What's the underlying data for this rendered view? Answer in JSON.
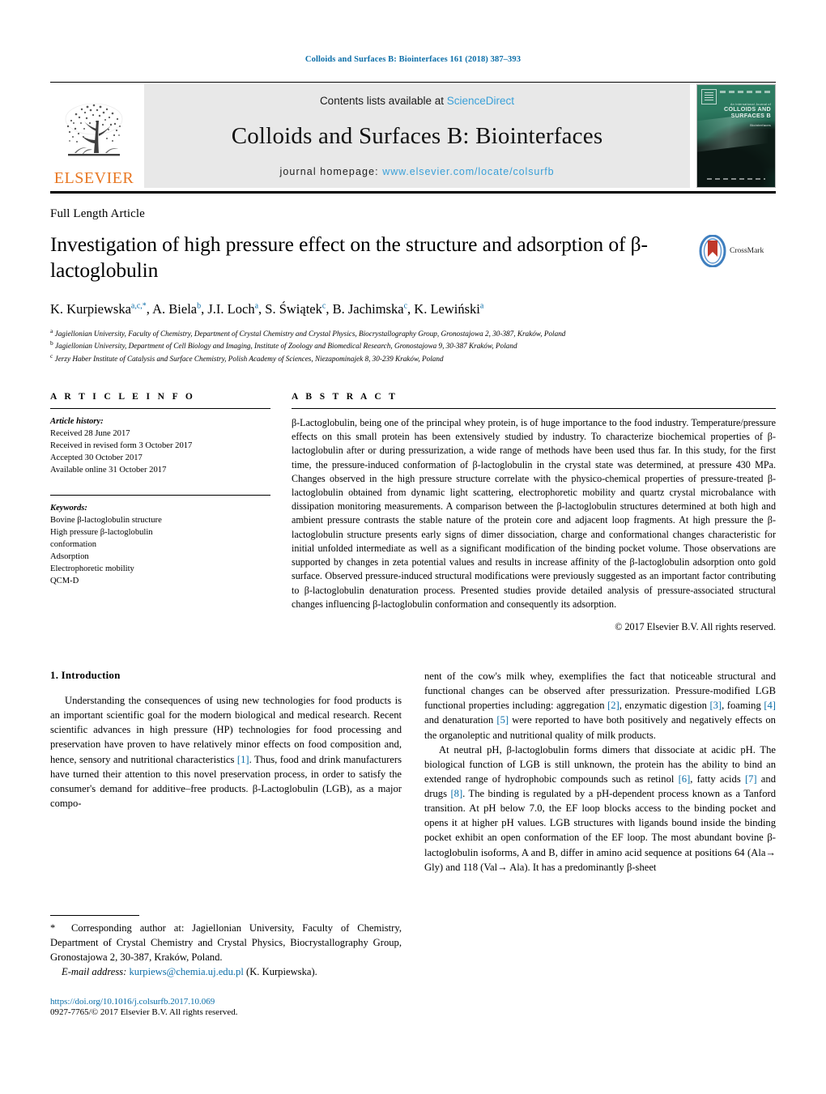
{
  "running_head": "Colloids and Surfaces B: Biointerfaces 161 (2018) 387–393",
  "masthead": {
    "contents_prefix": "Contents lists available at ",
    "sciencedirect": "ScienceDirect",
    "journal_title": "Colloids and Surfaces B: Biointerfaces",
    "homepage_label": "journal homepage: ",
    "homepage_url": "www.elsevier.com/locate/colsurfb",
    "publisher": "ELSEVIER",
    "cover": {
      "line_small": "An International Journal of",
      "line_main": "COLLOIDS AND SURFACES B",
      "line_sub": "Biointerfaces"
    },
    "accent_link_color": "#3aa0d8",
    "publisher_color": "#e87722"
  },
  "article": {
    "type": "Full Length Article",
    "title": "Investigation of high pressure effect on the structure and adsorption of β-lactoglobulin",
    "crossmark_label": "CrossMark",
    "authors_html": "K. Kurpiewska<sup>a,c,*</sup>, A. Biela<sup>b</sup>, J.I. Loch<sup>a</sup>, S. Świątek<sup>c</sup>, B. Jachimska<sup>c</sup>, K. Lewiński<sup>a</sup>",
    "affiliations": [
      "a Jagiellonian University, Faculty of Chemistry, Department of Crystal Chemistry and Crystal Physics, Biocrystallography Group, Gronostajowa 2, 30-387, Kraków, Poland",
      "b Jagiellonian University, Department of Cell Biology and Imaging, Institute of Zoology and Biomedical Research, Gronostajowa 9, 30-387 Kraków, Poland",
      "c Jerzy Haber Institute of Catalysis and Surface Chemistry, Polish Academy of Sciences, Niezapominajek 8, 30-239 Kraków, Poland"
    ]
  },
  "article_info": {
    "heading": "A R T I C L E   I N F O",
    "history_label": "Article history:",
    "history": [
      "Received 28 June 2017",
      "Received in revised form 3 October 2017",
      "Accepted 30 October 2017",
      "Available online 31 October 2017"
    ],
    "keywords_label": "Keywords:",
    "keywords": [
      "Bovine β-lactoglobulin structure",
      "High pressure β-lactoglobulin",
      "conformation",
      "Adsorption",
      "Electrophoretic mobility",
      "QCM-D"
    ]
  },
  "abstract": {
    "heading": "A B S T R A C T",
    "text": "β-Lactoglobulin, being one of the principal whey protein, is of huge importance to the food industry. Temperature/pressure effects on this small protein has been extensively studied by industry. To characterize biochemical properties of β-lactoglobulin after or during pressurization, a wide range of methods have been used thus far. In this study, for the first time, the pressure-induced conformation of β-lactoglobulin in the crystal state was determined, at pressure 430 MPa. Changes observed in the high pressure structure correlate with the physico-chemical properties of pressure-treated β-lactoglobulin obtained from dynamic light scattering, electrophoretic mobility and quartz crystal microbalance with dissipation monitoring measurements. A comparison between the β-lactoglobulin structures determined at both high and ambient pressure contrasts the stable nature of the protein core and adjacent loop fragments. At high pressure the β-lactoglobulin structure presents early signs of dimer dissociation, charge and conformational changes characteristic for initial unfolded intermediate as well as a significant modification of the binding pocket volume. Those observations are supported by changes in zeta potential values and results in increase affinity of the β-lactoglobulin adsorption onto gold surface. Observed pressure-induced structural modifications were previously suggested as an important factor contributing to β-lactoglobulin denaturation process. Presented studies provide detailed analysis of pressure-associated structural changes influencing β-lactoglobulin conformation and consequently its adsorption.",
    "copyright": "© 2017 Elsevier B.V. All rights reserved."
  },
  "introduction": {
    "heading": "1.  Introduction",
    "left_paragraph_html": "Understanding the consequences of using new technologies for food products is an important scientific goal for the modern biological and medical research. Recent scientific advances in high pressure (HP) technologies for food processing and preservation have proven to have relatively minor effects on food composition and, hence, sensory and nutritional characteristics <span class=\"ref\">[1]</span>. Thus, food and drink manufacturers have turned their attention to this novel preservation process, in order to satisfy the consumer's demand for additive–free products. β-Lactoglobulin (LGB), as a major compo-",
    "right_paragraph_1_html": "nent of the cow's milk whey, exemplifies the fact that noticeable structural and functional changes can be observed after pressurization. Pressure-modified LGB functional properties including: aggregation <span class=\"ref\">[2]</span>, enzymatic digestion <span class=\"ref\">[3]</span>, foaming <span class=\"ref\">[4]</span> and denaturation <span class=\"ref\">[5]</span> were reported to have both positively and negatively effects on the organoleptic and nutritional quality of milk products.",
    "right_paragraph_2_html": "At neutral pH, β-lactoglobulin forms dimers that dissociate at acidic pH. The biological function of LGB is still unknown, the protein has the ability to bind an extended range of hydrophobic compounds such as retinol <span class=\"ref\">[6]</span>, fatty acids <span class=\"ref\">[7]</span> and drugs <span class=\"ref\">[8]</span>. The binding is regulated by a pH-dependent process known as a Tanford transition. At pH below 7.0, the EF loop blocks access to the binding pocket and opens it at higher pH values. LGB structures with ligands bound inside the binding pocket exhibit an open conformation of the EF loop. The most abundant bovine β-lactoglobulin isoforms, A and B, differ in amino acid sequence at positions 64 (Ala→ Gly) and 118 (Val→ Ala). It has a predominantly β-sheet"
  },
  "footnotes": {
    "corresponding_html": "<span class=\"star\">*</span>&nbsp; Corresponding author at: Jagiellonian University, Faculty of Chemistry, Department of Crystal Chemistry and Crystal Physics, Biocrystallography Group, Gronostajowa 2, 30-387, Kraków, Poland.",
    "email_label": "E-mail address:",
    "email": "kurpiews@chemia.uj.edu.pl",
    "email_suffix": "(K. Kurpiewska).",
    "doi": "https://doi.org/10.1016/j.colsurfb.2017.10.069",
    "issn": "0927-7765/© 2017 Elsevier B.V. All rights reserved."
  }
}
